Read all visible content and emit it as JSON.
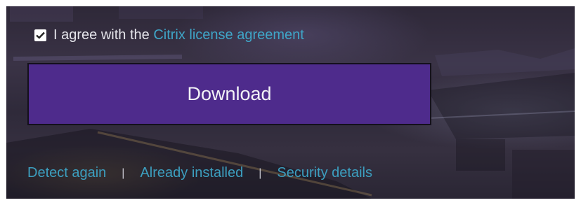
{
  "agreement": {
    "checked": true,
    "text": "I agree with the",
    "link_label": "Citrix license agreement"
  },
  "download_button": {
    "label": "Download"
  },
  "footer_links": {
    "detect_again": "Detect again",
    "separator": "|",
    "already_installed": "Already installed",
    "security_details": "Security details"
  },
  "colors": {
    "button": "#4e2b8c",
    "link": "#3fa6c8",
    "text": "#e4e4ea"
  }
}
